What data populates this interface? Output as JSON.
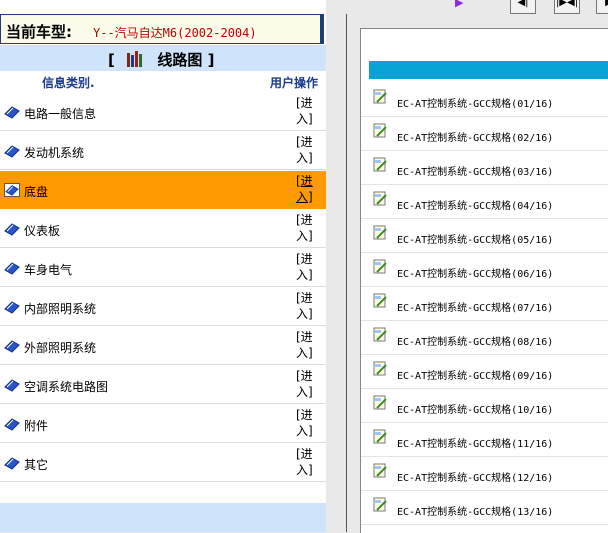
{
  "left": {
    "car_label": "当前车型:",
    "car_model": "Y--汽马自达M6(2002-2004)",
    "map_title_open": "[",
    "map_title": "线路图",
    "map_title_close": "]",
    "col_category": "信息类别.",
    "col_action": "用户操作",
    "categories": [
      {
        "label": "电路一般信息",
        "action": "[进入]"
      },
      {
        "label": "发动机系统",
        "action": "[进入]"
      },
      {
        "label": "底盘",
        "action": "[进入]"
      },
      {
        "label": "仪表板",
        "action": "[进入]"
      },
      {
        "label": "车身电气",
        "action": "[进入]"
      },
      {
        "label": "内部照明系统",
        "action": "[进入]"
      },
      {
        "label": "外部照明系统",
        "action": "[进入]"
      },
      {
        "label": "空调系统电路图",
        "action": "[进入]"
      },
      {
        "label": "附件",
        "action": "[进入]"
      },
      {
        "label": "其它",
        "action": "[进入]"
      }
    ],
    "active_index": 2
  },
  "right": {
    "pages": [
      "EC-AT控制系统-GCC规格(01/16)",
      "EC-AT控制系统-GCC规格(02/16)",
      "EC-AT控制系统-GCC规格(03/16)",
      "EC-AT控制系统-GCC规格(04/16)",
      "EC-AT控制系统-GCC规格(05/16)",
      "EC-AT控制系统-GCC规格(06/16)",
      "EC-AT控制系统-GCC规格(07/16)",
      "EC-AT控制系统-GCC规格(08/16)",
      "EC-AT控制系统-GCC规格(09/16)",
      "EC-AT控制系统-GCC规格(10/16)",
      "EC-AT控制系统-GCC规格(11/16)",
      "EC-AT控制系统-GCC规格(12/16)",
      "EC-AT控制系统-GCC规格(13/16)"
    ]
  },
  "colors": {
    "active_row": "#ff9900",
    "header_band": "#cfe3fa",
    "accent_bar": "#0aa3d6",
    "car_model_text": "#c00000"
  },
  "icons": {
    "category": "blue-diamond-icon",
    "page": "document-pencil-icon",
    "title": "books-icon"
  }
}
